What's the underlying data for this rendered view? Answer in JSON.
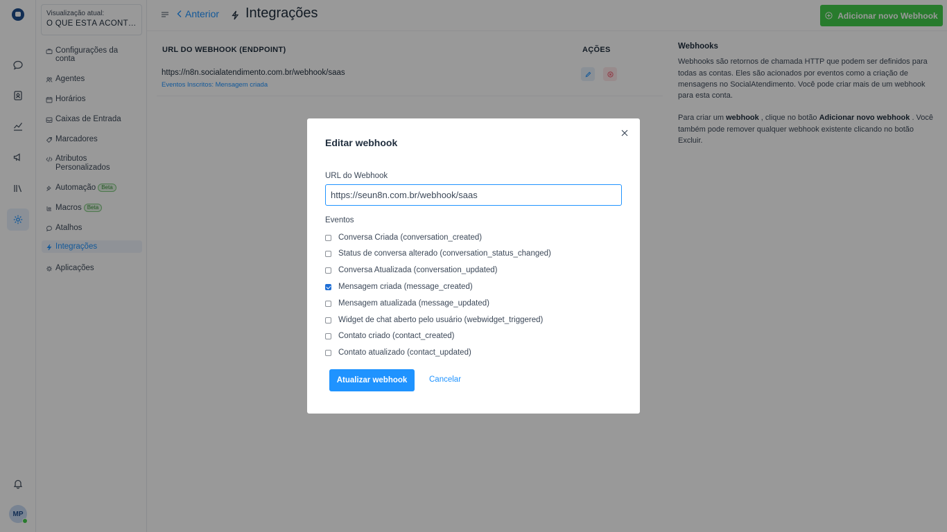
{
  "colors": {
    "accent": "#1f93ff",
    "success": "#44ce4b",
    "danger": "#f9a4ab",
    "overlay": "rgba(0,0,0,0.40)"
  },
  "rail": {
    "icons": [
      "chat-bubble-icon",
      "contacts-icon",
      "reports-icon",
      "megaphone-icon",
      "library-icon",
      "settings-icon"
    ],
    "active": "settings-icon",
    "notification_icon": "bell-icon",
    "avatar_initials": "MP"
  },
  "sidebar": {
    "view_label": "Visualização atual:",
    "view_value": "O QUE ESTÁ ACONTE...",
    "items": [
      {
        "label": "Configurações da conta",
        "icon": "briefcase-icon"
      },
      {
        "label": "Agentes",
        "icon": "people-icon"
      },
      {
        "label": "Horários",
        "icon": "calendar-clock-icon"
      },
      {
        "label": "Caixas de Entrada",
        "icon": "inbox-icon"
      },
      {
        "label": "Marcadores",
        "icon": "tag-icon"
      },
      {
        "label": "Atributos Personalizados",
        "icon": "code-icon"
      },
      {
        "label": "Automação",
        "icon": "automation-icon",
        "badge": "Beta"
      },
      {
        "label": "Macros",
        "icon": "macros-icon",
        "badge": "Beta"
      },
      {
        "label": "Atalhos",
        "icon": "chat-shortcut-icon"
      },
      {
        "label": "Integrações",
        "icon": "flash-icon"
      },
      {
        "label": "Aplicações",
        "icon": "apps-icon"
      }
    ],
    "active": "Integrações"
  },
  "header": {
    "back_label": "Anterior",
    "title": "Integrações",
    "add_button": "Adicionar novo Webhook"
  },
  "table": {
    "col_url": "URL DO WEBHOOK (ENDPOINT)",
    "col_actions": "AÇÕES",
    "rows": [
      {
        "url": "https://n8n.socialatendimento.com.br/webhook/saas",
        "events": "Eventos Inscritos: Mensagem criada"
      }
    ]
  },
  "info": {
    "title": "Webhooks",
    "p1": "Webhooks são retornos de chamada HTTP que podem ser definidos para todas as contas. Eles são acionados por eventos como a criação de mensagens no SocialAtendimento. Você pode criar mais de um webhook para esta conta.",
    "p2_pre": "Para criar um ",
    "p2_b1": "webhook",
    "p2_mid": " , clique no botão ",
    "p2_b2": "Adicionar novo webhook",
    "p2_post": " . Você também pode remover qualquer webhook existente clicando no botão Excluir."
  },
  "modal": {
    "title": "Editar webhook",
    "url_label": "URL do Webhook",
    "url_value": "https://seun8n.com.br/webhook/saas",
    "events_label": "Eventos",
    "events": [
      {
        "label": "Conversa Criada (conversation_created)",
        "checked": false
      },
      {
        "label": "Status de conversa alterado (conversation_status_changed)",
        "checked": false
      },
      {
        "label": "Conversa Atualizada (conversation_updated)",
        "checked": false
      },
      {
        "label": "Mensagem criada (message_created)",
        "checked": true
      },
      {
        "label": "Mensagem atualizada (message_updated)",
        "checked": false
      },
      {
        "label": "Widget de chat aberto pelo usuário (webwidget_triggered)",
        "checked": false
      },
      {
        "label": "Contato criado (contact_created)",
        "checked": false
      },
      {
        "label": "Contato atualizado (contact_updated)",
        "checked": false
      }
    ],
    "submit": "Atualizar webhook",
    "cancel": "Cancelar"
  }
}
